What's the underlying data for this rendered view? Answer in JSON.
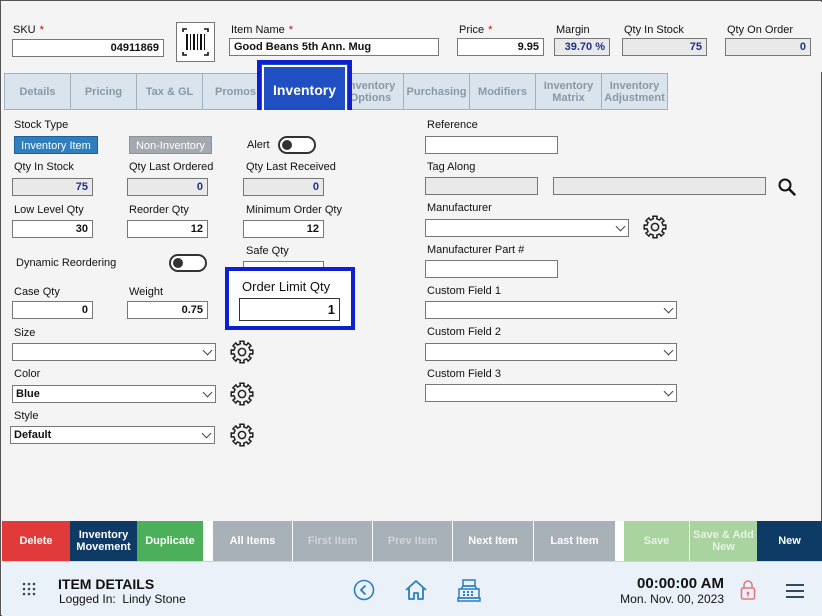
{
  "header": {
    "sku_label": "SKU",
    "sku_value": "04911869",
    "item_name_label": "Item Name",
    "item_name_value": "Good Beans 5th Ann. Mug",
    "price_label": "Price",
    "price_value": "9.95",
    "margin_label": "Margin",
    "margin_value": "39.70 %",
    "qty_in_stock_label": "Qty In Stock",
    "qty_in_stock_value": "75",
    "qty_on_order_label": "Qty On Order",
    "qty_on_order_value": "0",
    "required_mark": "*"
  },
  "tabs": [
    {
      "label": "Details"
    },
    {
      "label": "Pricing"
    },
    {
      "label": "Tax & GL"
    },
    {
      "label": "Promos"
    },
    {
      "label": "Inventory"
    },
    {
      "label": "Inventory Options"
    },
    {
      "label": "Purchasing"
    },
    {
      "label": "Modifiers"
    },
    {
      "label": "Inventory Matrix"
    },
    {
      "label": "Inventory Adjustment"
    }
  ],
  "left": {
    "stock_type_label": "Stock Type",
    "inventory_item": "Inventory Item",
    "non_inventory": "Non-Inventory",
    "alert_label": "Alert",
    "qty_in_stock_label": "Qty In Stock",
    "qty_in_stock_value": "75",
    "qty_last_ordered_label": "Qty Last Ordered",
    "qty_last_ordered_value": "0",
    "qty_last_received_label": "Qty Last Received",
    "qty_last_received_value": "0",
    "low_level_label": "Low Level Qty",
    "low_level_value": "30",
    "reorder_label": "Reorder Qty",
    "reorder_value": "12",
    "min_order_label": "Minimum Order Qty",
    "min_order_value": "12",
    "dynamic_label": "Dynamic Reordering",
    "safe_qty_label": "Safe Qty",
    "order_limit_label": "Order Limit Qty",
    "order_limit_value": "1",
    "case_qty_label": "Case Qty",
    "case_qty_value": "0",
    "weight_label": "Weight",
    "weight_value": "0.75",
    "size_label": "Size",
    "size_value": "",
    "color_label": "Color",
    "color_value": "Blue",
    "style_label": "Style",
    "style_value": "Default"
  },
  "right": {
    "reference_label": "Reference",
    "tag_along_label": "Tag Along",
    "manufacturer_label": "Manufacturer",
    "manufacturer_part_label": "Manufacturer Part #",
    "custom1_label": "Custom Field 1",
    "custom2_label": "Custom Field 2",
    "custom3_label": "Custom Field 3"
  },
  "toolbar": {
    "delete": "Delete",
    "inventory_movement": "Inventory Movement",
    "duplicate": "Duplicate",
    "all_items": "All Items",
    "first_item": "First Item",
    "prev_item": "Prev Item",
    "next_item": "Next Item",
    "last_item": "Last Item",
    "save": "Save",
    "save_add_new": "Save & Add New",
    "new": "New"
  },
  "footer": {
    "title": "ITEM DETAILS",
    "logged_in_label": "Logged In:",
    "user": "Lindy Stone",
    "time": "00:00:00 AM",
    "date": "Mon. Nov. 00, 2023"
  },
  "colors": {
    "accent_blue": "#0c1fd1",
    "tab_active": "#1f4fc2",
    "stock_active": "#2f7fc0",
    "delete": "#e03a3a",
    "movement": "#0e3a66",
    "duplicate": "#4caf5a",
    "nav_gray": "#a8b0b8",
    "save_green": "#a9d39f",
    "new_blue": "#0d3b66"
  }
}
